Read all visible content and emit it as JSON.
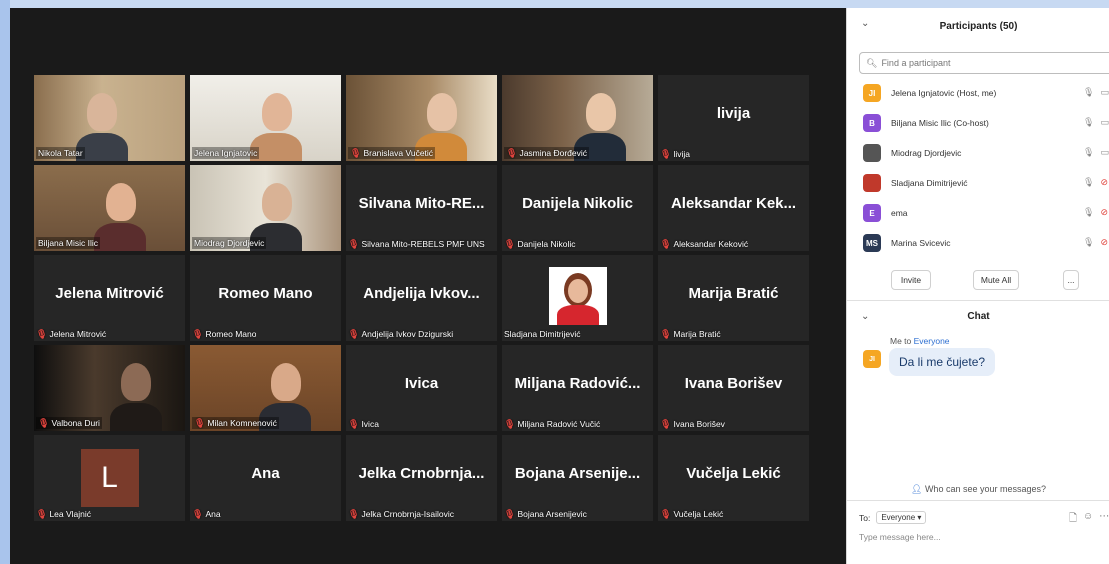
{
  "colors": {
    "accent_active": "#b9e26d",
    "mute_red": "#e0443e",
    "link_blue": "#2d6fd1"
  },
  "tiles": [
    {
      "name": "Nikola Tatar",
      "muted": false,
      "video": true,
      "active": false
    },
    {
      "name": "Jelena Ignjatovic",
      "muted": false,
      "video": true,
      "active": true
    },
    {
      "name": "Branislava Vučetić",
      "muted": true,
      "video": true,
      "active": false
    },
    {
      "name": "Jasmina Đorđević",
      "muted": true,
      "video": true,
      "active": false
    },
    {
      "display": "livija",
      "name": "livija",
      "muted": true,
      "video": false,
      "active": false
    },
    {
      "name": "Biljana Misic Ilic",
      "muted": false,
      "video": true,
      "active": false
    },
    {
      "name": "Miodrag Djordjevic",
      "muted": false,
      "video": true,
      "active": false
    },
    {
      "display": "Silvana  Mito-RE...",
      "name": "Silvana Mito-REBELS PMF UNS",
      "muted": true,
      "video": false,
      "active": false
    },
    {
      "display": "Danijela Nikolic",
      "name": "Danijela Nikolic",
      "muted": true,
      "video": false,
      "active": false
    },
    {
      "display": "Aleksandar  Kek...",
      "name": "Aleksandar Keković",
      "muted": true,
      "video": false,
      "active": false
    },
    {
      "display": "Jelena Mitrović",
      "name": "Jelena Mitrović",
      "muted": true,
      "video": false,
      "active": false
    },
    {
      "display": "Romeo Mano",
      "name": "Romeo Mano",
      "muted": true,
      "video": false,
      "active": false
    },
    {
      "display": "Andjelija  Ivkov...",
      "name": "Andjelija Ivkov Dzigurski",
      "muted": true,
      "video": false,
      "active": false
    },
    {
      "name": "Sladjana Dimitrijević",
      "muted": false,
      "video": false,
      "portrait": true,
      "active": false
    },
    {
      "display": "Marija Bratić",
      "name": "Marija Bratić",
      "muted": true,
      "video": false,
      "active": false
    },
    {
      "name": "Valbona Duri",
      "muted": true,
      "video": true,
      "active": false
    },
    {
      "name": "Milan Komnenović",
      "muted": true,
      "video": true,
      "active": false
    },
    {
      "display": "Ivica",
      "name": "Ivica",
      "muted": true,
      "video": false,
      "active": false
    },
    {
      "display": "Miljana  Radović...",
      "name": "Miljana Radović Vučić",
      "muted": true,
      "video": false,
      "active": false
    },
    {
      "display": "Ivana Borišev",
      "name": "Ivana Borišev",
      "muted": true,
      "video": false,
      "active": false
    },
    {
      "avatar_letter": "L",
      "name": "Lea Vlajnić",
      "muted": true,
      "video": false,
      "active": false
    },
    {
      "display": "Ana",
      "name": "Ana",
      "muted": true,
      "video": false,
      "active": false
    },
    {
      "display": "Jelka  Crnobrnja...",
      "name": "Jelka Crnobrnja-Isailovic",
      "muted": true,
      "video": false,
      "active": false
    },
    {
      "display": "Bojana  Arsenije...",
      "name": "Bojana Arsenijevic",
      "muted": true,
      "video": false,
      "active": false
    },
    {
      "display": "Vučelja Lekić",
      "name": "Vučelja Lekić",
      "muted": true,
      "video": false,
      "active": false
    }
  ],
  "participants_panel": {
    "title": "Participants (50)",
    "search_placeholder": "Find a participant",
    "list": [
      {
        "initials": "JI",
        "color": "#f5a623",
        "name": "Jelena Ignjatovic (Host, me)",
        "mic": "on",
        "video": "on"
      },
      {
        "initials": "B",
        "color": "#8a4fd6",
        "name": "Biljana Misic Ilic (Co-host)",
        "mic": "on",
        "video": "on"
      },
      {
        "initials": "",
        "color": "#555555",
        "name": "Miodrag Djordjevic",
        "mic": "on",
        "video": "on"
      },
      {
        "initials": "",
        "color": "#c0392b",
        "name": "Sladjana Dimitrijević",
        "mic": "on",
        "video": "off"
      },
      {
        "initials": "E",
        "color": "#8a4fd6",
        "name": "ema",
        "mic": "on",
        "video": "off"
      },
      {
        "initials": "MS",
        "color": "#2b3a55",
        "name": "Marina Svicevic",
        "mic": "on",
        "video": "off"
      }
    ],
    "invite_label": "Invite",
    "mute_all_label": "Mute All",
    "more_label": "..."
  },
  "chat": {
    "title": "Chat",
    "sender_prefix": "Me to ",
    "recipient": "Everyone",
    "sender_initials": "JI",
    "message": "Da li me čujete?",
    "who_can_see": "Who can see your messages?",
    "to_label": "To:",
    "to_value": "Everyone",
    "input_placeholder": "Type message here..."
  }
}
